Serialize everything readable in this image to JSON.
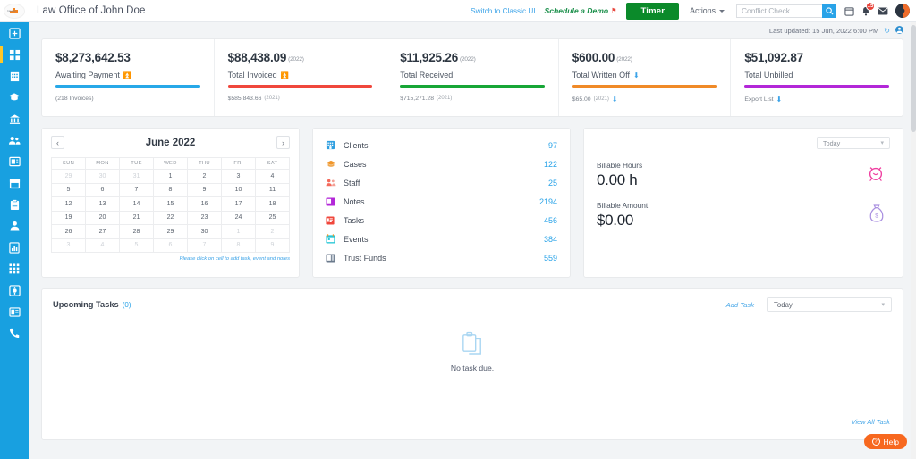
{
  "topbar": {
    "app_title": "Law Office of John Doe",
    "switch_classic": "Switch to Classic UI",
    "schedule_demo": "Schedule a Demo",
    "timer_label": "Timer",
    "actions_label": "Actions",
    "search_placeholder": "Conflict Check",
    "notification_count": "15",
    "icons": [
      "search-icon",
      "calendar-icon",
      "bell-icon",
      "envelope-icon",
      "user-avatar"
    ]
  },
  "sidebar": {
    "items": [
      {
        "name": "add-new",
        "icon": "plus-box-icon",
        "active": false
      },
      {
        "name": "dashboard",
        "icon": "dashboard-grid-icon",
        "active": true
      },
      {
        "name": "clients",
        "icon": "building-icon",
        "active": false
      },
      {
        "name": "cases",
        "icon": "graduation-cap-icon",
        "active": false
      },
      {
        "name": "courts",
        "icon": "bank-icon",
        "active": false
      },
      {
        "name": "staff",
        "icon": "people-icon",
        "active": false
      },
      {
        "name": "notes",
        "icon": "notes-icon",
        "active": false
      },
      {
        "name": "calendar",
        "icon": "calendar-icon",
        "active": false
      },
      {
        "name": "tasks",
        "icon": "clipboard-icon",
        "active": false
      },
      {
        "name": "contacts",
        "icon": "person-icon",
        "active": false
      },
      {
        "name": "reports",
        "icon": "chart-icon",
        "active": false
      },
      {
        "name": "apps",
        "icon": "apps-grid-icon",
        "active": false
      },
      {
        "name": "settings",
        "icon": "gear-icon",
        "active": false
      },
      {
        "name": "billing",
        "icon": "window-icon",
        "active": false
      },
      {
        "name": "phone",
        "icon": "phone-icon",
        "active": false
      }
    ]
  },
  "status": {
    "last_updated": "Last updated: 15 Jun, 2022 6:00 PM"
  },
  "stats": [
    {
      "amount": "$8,273,642.53",
      "year": "",
      "label": "Awaiting Payment",
      "has_external_link": true,
      "has_download": false,
      "bar_color": "#27a8e8",
      "sub": "(218 Invoices)",
      "sub_year": "",
      "sub_download": false
    },
    {
      "amount": "$88,438.09",
      "year": "(2022)",
      "label": "Total Invoiced",
      "has_external_link": true,
      "has_download": false,
      "bar_color": "#f0473c",
      "sub": "$585,843.66",
      "sub_year": "(2021)",
      "sub_download": false
    },
    {
      "amount": "$11,925.26",
      "year": "(2022)",
      "label": "Total Received",
      "has_external_link": false,
      "has_download": false,
      "bar_color": "#17a636",
      "sub": "$715,271.28",
      "sub_year": "(2021)",
      "sub_download": false
    },
    {
      "amount": "$600.00",
      "year": "(2022)",
      "label": "Total Written Off",
      "has_external_link": false,
      "has_download": true,
      "bar_color": "#f08a27",
      "sub": "$65.00",
      "sub_year": "(2021)",
      "sub_download": true
    },
    {
      "amount": "$51,092.87",
      "year": "",
      "label": "Total Unbilled",
      "has_external_link": false,
      "has_download": false,
      "bar_color": "#b327d8",
      "sub": "Export List",
      "sub_year": "",
      "sub_download": true
    }
  ],
  "calendar": {
    "title": "June 2022",
    "prev_label": "‹",
    "next_label": "›",
    "weekdays": [
      "SUN",
      "MON",
      "TUE",
      "WED",
      "THU",
      "FRI",
      "SAT"
    ],
    "weeks": [
      [
        {
          "d": "29",
          "m": true
        },
        {
          "d": "30",
          "m": true
        },
        {
          "d": "31",
          "m": true
        },
        {
          "d": "1",
          "m": false
        },
        {
          "d": "2",
          "m": false
        },
        {
          "d": "3",
          "m": false
        },
        {
          "d": "4",
          "m": false
        }
      ],
      [
        {
          "d": "5",
          "m": false
        },
        {
          "d": "6",
          "m": false
        },
        {
          "d": "7",
          "m": false
        },
        {
          "d": "8",
          "m": false
        },
        {
          "d": "9",
          "m": false
        },
        {
          "d": "10",
          "m": false
        },
        {
          "d": "11",
          "m": false
        }
      ],
      [
        {
          "d": "12",
          "m": false
        },
        {
          "d": "13",
          "m": false
        },
        {
          "d": "14",
          "m": false
        },
        {
          "d": "15",
          "m": false
        },
        {
          "d": "16",
          "m": false
        },
        {
          "d": "17",
          "m": false
        },
        {
          "d": "18",
          "m": false
        }
      ],
      [
        {
          "d": "19",
          "m": false
        },
        {
          "d": "20",
          "m": false
        },
        {
          "d": "21",
          "m": false
        },
        {
          "d": "22",
          "m": false
        },
        {
          "d": "23",
          "m": false
        },
        {
          "d": "24",
          "m": false
        },
        {
          "d": "25",
          "m": false
        }
      ],
      [
        {
          "d": "26",
          "m": false
        },
        {
          "d": "27",
          "m": false
        },
        {
          "d": "28",
          "m": false
        },
        {
          "d": "29",
          "m": false
        },
        {
          "d": "30",
          "m": false
        },
        {
          "d": "1",
          "m": true
        },
        {
          "d": "2",
          "m": true
        }
      ],
      [
        {
          "d": "3",
          "m": true
        },
        {
          "d": "4",
          "m": true
        },
        {
          "d": "5",
          "m": true
        },
        {
          "d": "6",
          "m": true
        },
        {
          "d": "7",
          "m": true
        },
        {
          "d": "8",
          "m": true
        },
        {
          "d": "9",
          "m": true
        }
      ]
    ],
    "note": "Please click on cell to add task, event and notes"
  },
  "entity_counts": [
    {
      "label": "Clients",
      "count": "97",
      "icon": "building-icon",
      "color": "#2f9fe0"
    },
    {
      "label": "Cases",
      "count": "122",
      "icon": "folder-icon",
      "color": "#f0962a"
    },
    {
      "label": "Staff",
      "count": "25",
      "icon": "people-icon",
      "color": "#f4695a"
    },
    {
      "label": "Notes",
      "count": "2194",
      "icon": "note-icon",
      "color": "#b327d8"
    },
    {
      "label": "Tasks",
      "count": "456",
      "icon": "task-icon",
      "color": "#f0473c"
    },
    {
      "label": "Events",
      "count": "384",
      "icon": "calendar-icon",
      "color": "#25c6d6"
    },
    {
      "label": "Trust Funds",
      "count": "559",
      "icon": "wallet-icon",
      "color": "#6b7a8c"
    }
  ],
  "billable": {
    "period": "Today",
    "hours_label": "Billable Hours",
    "hours_value": "0.00 h",
    "amount_label": "Billable Amount",
    "amount_value": "$0.00",
    "clock_color": "#ef3fa0",
    "bag_color": "#a98fe0"
  },
  "tasks": {
    "title": "Upcoming Tasks",
    "count": "(0)",
    "add_task": "Add Task",
    "period": "Today",
    "empty_text": "No task due.",
    "view_all": "View All Task"
  },
  "help": {
    "label": "Help"
  }
}
